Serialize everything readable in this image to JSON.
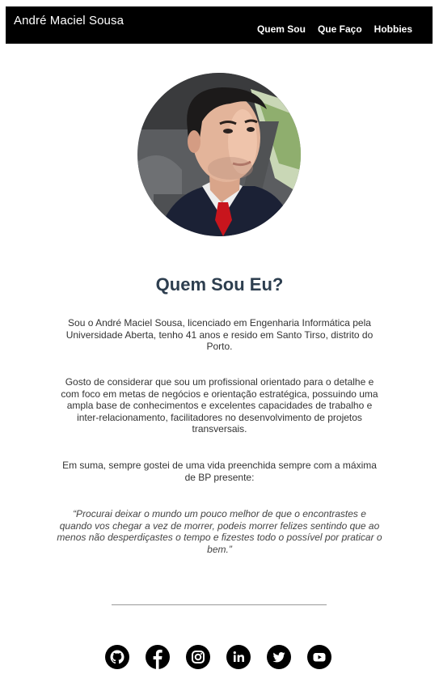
{
  "navbar": {
    "brand": "André Maciel Sousa",
    "links": [
      {
        "label": "Quem Sou"
      },
      {
        "label": "Que Faço"
      },
      {
        "label": "Hobbies"
      }
    ]
  },
  "profile": {
    "photo_icon": "profile-photo"
  },
  "about": {
    "title": "Quem Sou Eu?",
    "paragraph1": "Sou o André Maciel Sousa, licenciado em Engenharia Informática pela Universidade Aberta, tenho 41 anos e resido em Santo Tirso, distrito do Porto.",
    "paragraph2": "Gosto de considerar que sou um profissional orientado para o detalhe e com foco em metas de negócios e orientação estratégica, possuindo uma ampla base de conhecimentos e excelentes capacidades de trabalho e inter-relacionamento, facilitadores no desenvolvimento de projetos transversais.",
    "paragraph3": "Em suma, sempre gostei de uma vida preenchida sempre com a máxima de BP presente:",
    "quote": "“Procurai deixar o mundo um pouco melhor de que o encontrastes e quando vos chegar a vez de morrer, podeis morrer felizes sentindo que ao menos não desperdiçastes o tempo e fizestes todo o possível por praticar o bem.”"
  },
  "social": {
    "icons": [
      "github-icon",
      "facebook-icon",
      "instagram-icon",
      "linkedin-icon",
      "twitter-icon",
      "youtube-icon"
    ]
  },
  "colors": {
    "navbar_bg": "#000000",
    "title": "#2d3e4f"
  }
}
